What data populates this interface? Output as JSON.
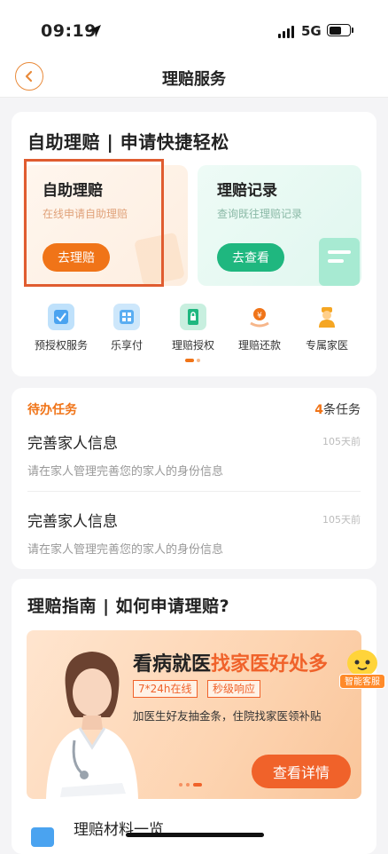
{
  "status": {
    "time": "09:19",
    "network": "5G"
  },
  "nav": {
    "title": "理赔服务"
  },
  "self_service": {
    "title": "自助理赔 | 申请快捷轻松",
    "tile_self": {
      "title": "自助理赔",
      "subtitle": "在线申请自助理赔",
      "button": "去理赔"
    },
    "tile_record": {
      "title": "理赔记录",
      "subtitle": "查询既往理赔记录",
      "button": "去查看"
    },
    "shortcuts": [
      {
        "label": "预授权服务",
        "icon": "shield-check-icon"
      },
      {
        "label": "乐享付",
        "icon": "qr-card-icon"
      },
      {
        "label": "理赔授权",
        "icon": "phone-lock-icon"
      },
      {
        "label": "理赔还款",
        "icon": "coin-hand-icon"
      },
      {
        "label": "专属家医",
        "icon": "doctor-icon"
      }
    ]
  },
  "todo": {
    "label": "待办任务",
    "count": "4",
    "count_suffix": "条任务",
    "tasks": [
      {
        "title": "完善家人信息",
        "desc": "请在家人管理完善您的家人的身份信息",
        "time": "105天前"
      },
      {
        "title": "完善家人信息",
        "desc": "请在家人管理完善您的家人的身份信息",
        "time": "105天前"
      }
    ]
  },
  "guide": {
    "title": "理赔指南 | 如何申请理赔?",
    "banner": {
      "headline_a": "看病就医",
      "headline_b": "找家医好处多",
      "tag1": "7*24h在线",
      "tag2": "秒级响应",
      "subtitle": "加医生好友抽金条，住院找家医领补贴",
      "button": "查看详情"
    },
    "service_label": "智能客服"
  },
  "materials": {
    "label": "理赔材料一览"
  },
  "colors": {
    "accent": "#f07418",
    "green": "#1fb77f",
    "highlight": "#e05c30"
  }
}
